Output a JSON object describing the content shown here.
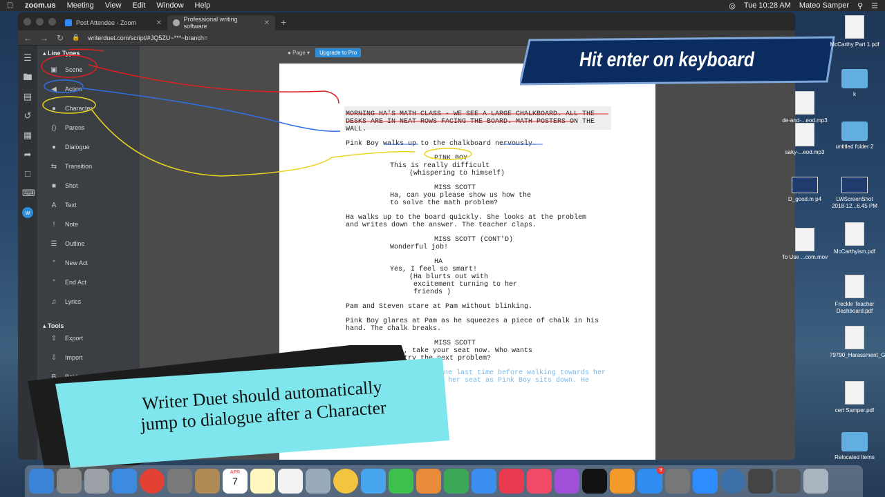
{
  "menubar": {
    "app_name": "zoom.us",
    "items": [
      "Meeting",
      "View",
      "Edit",
      "Window",
      "Help"
    ],
    "clock": "Tue 10:28 AM",
    "user": "Mateo Samper"
  },
  "browser": {
    "tabs": [
      {
        "title": "Post Attendee - Zoom"
      },
      {
        "title": "Professional writing software"
      }
    ],
    "url": "writerduet.com/script/#JQ5ZU~***~branch="
  },
  "toolbar": {
    "page_label": "Page",
    "upgrade_label": "Upgrade to Pro"
  },
  "sidebar": {
    "line_types_title": "Line Types",
    "line_types": [
      {
        "label": "Scene",
        "icon": "scene-icon"
      },
      {
        "label": "Action",
        "icon": "megaphone-icon"
      },
      {
        "label": "Character",
        "icon": "person-icon"
      },
      {
        "label": "Parens",
        "icon": "parens-icon"
      },
      {
        "label": "Dialogue",
        "icon": "speech-bubble-icon"
      },
      {
        "label": "Transition",
        "icon": "transition-icon"
      },
      {
        "label": "Shot",
        "icon": "camera-icon"
      },
      {
        "label": "Text",
        "icon": "text-icon"
      },
      {
        "label": "Note",
        "icon": "exclamation-icon"
      },
      {
        "label": "Outline",
        "icon": "list-icon"
      },
      {
        "label": "New Act",
        "icon": "quote-icon"
      },
      {
        "label": "End Act",
        "icon": "quote-icon"
      },
      {
        "label": "Lyrics",
        "icon": "music-note-icon"
      }
    ],
    "tools_title": "Tools",
    "tools": [
      {
        "label": "Export",
        "icon": "export-icon"
      },
      {
        "label": "Import",
        "icon": "import-icon"
      },
      {
        "label": "Bold",
        "icon": "bold-icon"
      }
    ]
  },
  "script": {
    "scene_lines": [
      "MORNING HA'S MATH CLASS - WE SEE A LARGE CHALKBOARD. ALL THE",
      "DESKS ARE IN NEAT ROWS FACING THE BOARD. MATH POSTERS ON THE",
      "WALL."
    ],
    "lines": [
      "Pink Boy walks up to the chalkboard nervously.",
      "PINK BOY",
      "This is really difficult",
      "(whispering to himself)",
      "MISS SCOTT",
      "Ha, can you please show us how the",
      "to solve the math problem?",
      "Ha walks up to the board quickly. She looks at the problem",
      "and writes down the answer. The teacher claps.",
      "MISS SCOTT (CONT'D)",
      "Wonderful job!",
      "HA",
      "Yes, I feel so smart!",
      "(Ha blurts out with",
      " excitement turning to her",
      " friends )",
      "Pam and Steven stare at Pam without blinking.",
      "Pink Boy glares at Pam as he squeezes a piece of chalk in his",
      "hand. The chalk breaks.",
      "MISS SCOTT",
      ", take your seat now. Who wants",
      "try the next problem?",
      "k Boy one last time before walking towards her",
      "d takes her seat as Pink Boy sits down. He"
    ]
  },
  "overlay": {
    "banner_text": "Hit enter on keyboard",
    "sticky_line1": "Writer Duet should automatically",
    "sticky_line2": "jump to dialogue after a Character"
  },
  "desktop_icons": [
    {
      "label": "McCarthy Part 1.pdf"
    },
    {
      "label": "k"
    },
    {
      "label": "de-and-...eod.mp3"
    },
    {
      "label": "untitled folder 2"
    },
    {
      "label": "saky-...eod.mp3"
    },
    {
      "label": "D_good.m p4"
    },
    {
      "label": "LWScreenShot 2018-12...6.45 PM"
    },
    {
      "label": "To Use ...com.mov"
    },
    {
      "label": "McCarthyism.pdf"
    },
    {
      "label": "Freckle Teacher Dashboard.pdf"
    },
    {
      "label": "79790_Harassment_Genera...883.pdf"
    },
    {
      "label": "cert Samper.pdf"
    },
    {
      "label": "Relocated Items"
    }
  ],
  "dock": {
    "calendar_day": "7",
    "calendar_month": "APR",
    "appstore_badge": "9"
  }
}
